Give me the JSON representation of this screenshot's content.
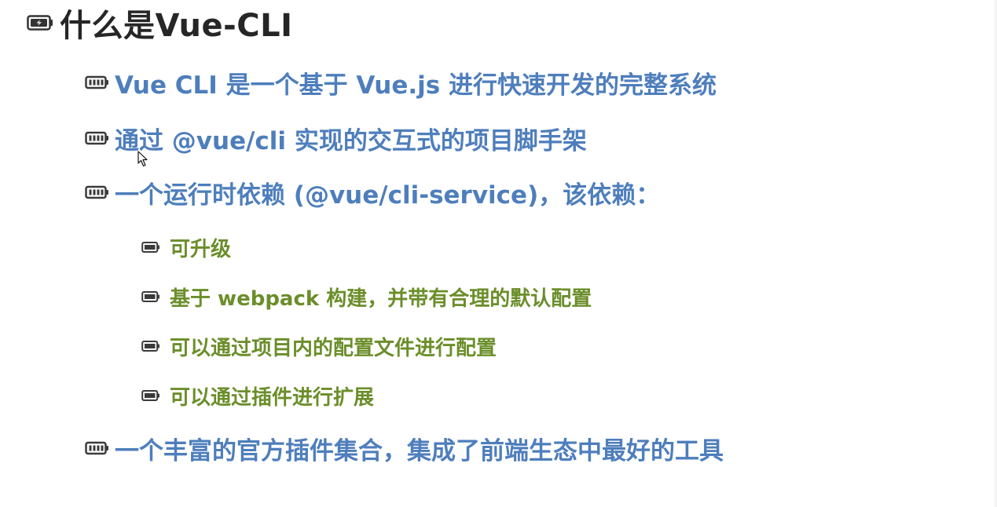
{
  "slide": {
    "title": "什么是Vue-CLI",
    "items": [
      {
        "level": 1,
        "text": "Vue CLI 是一个基于 Vue.js 进行快速开发的完整系统"
      },
      {
        "level": 1,
        "text": "通过 @vue/cli 实现的交互式的项目脚手架"
      },
      {
        "level": 1,
        "text": "一个运行时依赖 (@vue/cli-service)，该依赖："
      },
      {
        "level": 2,
        "text": "可升级"
      },
      {
        "level": 2,
        "text": "基于 webpack 构建，并带有合理的默认配置"
      },
      {
        "level": 2,
        "text": "可以通过项目内的配置文件进行配置"
      },
      {
        "level": 2,
        "text": "可以通过插件进行扩展"
      },
      {
        "level": 1,
        "text": "一个丰富的官方插件集合，集成了前端生态中最好的工具"
      }
    ]
  },
  "colors": {
    "title": "#262626",
    "level1": "#4e7ebc",
    "level2": "#6b8e2a"
  },
  "icons": {
    "title_bullet": "battery-charging-icon",
    "item_bullet": "battery-icon",
    "pointer": "mouse-cursor-icon"
  }
}
